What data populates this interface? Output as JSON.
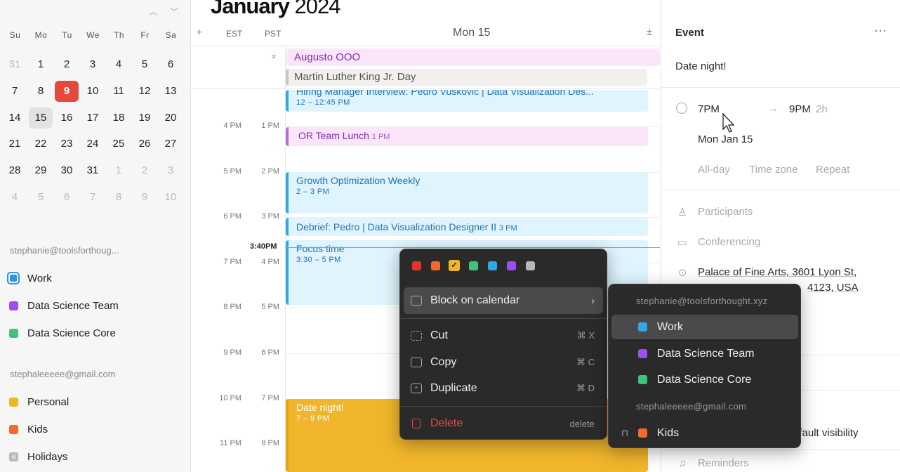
{
  "mini_calendar": {
    "weekdays": [
      "Su",
      "Mo",
      "Tu",
      "We",
      "Th",
      "Fr",
      "Sa"
    ],
    "weeks": [
      [
        "31",
        "1",
        "2",
        "3",
        "4",
        "5",
        "6"
      ],
      [
        "7",
        "8",
        "9",
        "10",
        "11",
        "12",
        "13"
      ],
      [
        "14",
        "15",
        "16",
        "17",
        "18",
        "19",
        "20"
      ],
      [
        "21",
        "22",
        "23",
        "24",
        "25",
        "26",
        "27"
      ],
      [
        "28",
        "29",
        "30",
        "31",
        "1",
        "2",
        "3"
      ],
      [
        "4",
        "5",
        "6",
        "7",
        "8",
        "9",
        "10"
      ]
    ],
    "today": "9",
    "selected": "15"
  },
  "accounts": [
    {
      "email": "stephanie@toolsforthoug...",
      "calendars": [
        {
          "name": "Work",
          "color": "#2c96e0"
        },
        {
          "name": "Data Science Team",
          "color": "#9a4ff0"
        },
        {
          "name": "Data Science Core",
          "color": "#3fc27a"
        }
      ]
    },
    {
      "email": "stephaleeeee@gmail.com",
      "calendars": [
        {
          "name": "Personal",
          "color": "#f0b52b"
        },
        {
          "name": "Kids",
          "color": "#f26a2e"
        },
        {
          "name": "Holidays",
          "color": "#b8b8b8"
        }
      ]
    }
  ],
  "main": {
    "title_month": "January",
    "title_year": "2024",
    "add_label": "+",
    "tz1": "EST",
    "tz2": "PST",
    "day_header": "Mon 15",
    "expand_label": "±",
    "now_time": "3:40PM",
    "hours_est": [
      "4 PM",
      "5 PM",
      "6 PM",
      "7 PM",
      "8 PM",
      "9 PM",
      "10 PM",
      "11 PM"
    ],
    "hours_pst": [
      "1 PM",
      "2 PM",
      "3 PM",
      "4 PM",
      "5 PM",
      "6 PM",
      "7 PM",
      "8 PM"
    ],
    "all_day": [
      {
        "title": "Augusto OOO"
      },
      {
        "title": "Martin Luther King Jr. Day"
      }
    ],
    "events": {
      "hiring": {
        "title": "Hiring Manager Interview: Pedro Vuskovic | Data Visualization Des...",
        "time": "12 – 12:45 PM"
      },
      "lunch": {
        "title": "OR Team Lunch",
        "time": "1 PM"
      },
      "growth": {
        "title": "Growth Optimization Weekly",
        "time": "2 – 3 PM"
      },
      "debrief": {
        "title": "Debrief: Pedro | Data Visualization Designer II",
        "time": "3 PM"
      },
      "focus": {
        "title": "Focus time",
        "time": "3:30 – 5 PM"
      },
      "date": {
        "title": "Date night!",
        "time": "7 – 9 PM"
      }
    }
  },
  "panel": {
    "header": "Event",
    "more": "···",
    "title": "Date night!",
    "start": "7PM",
    "end": "9PM",
    "duration": "2h",
    "date": "Mon Jan 15",
    "all_day": "All-day",
    "time_zone": "Time zone",
    "repeat": "Repeat",
    "participants": "Participants",
    "conferencing": "Conferencing",
    "location_line1": "Palace of Fine Arts, 3601 Lyon St,",
    "location_line2": "4123, USA",
    "visibility": "efault visibility",
    "reminders": "Reminders"
  },
  "menu": {
    "colors": [
      "#e5332a",
      "#f26a2e",
      "#f0b52b",
      "#3fc27a",
      "#2ea9e8",
      "#9a4ff0",
      "#b8b8b8"
    ],
    "block": "Block on calendar",
    "cut": "Cut",
    "cut_sc": "⌘ X",
    "copy": "Copy",
    "copy_sc": "⌘ C",
    "duplicate": "Duplicate",
    "duplicate_sc": "⌘ D",
    "delete": "Delete",
    "delete_sc": "delete"
  },
  "submenu": {
    "account1": "stephanie@toolsforthought.xyz",
    "account2": "stephaleeeee@gmail.com",
    "items": [
      {
        "name": "Work",
        "color": "#2ea9e8"
      },
      {
        "name": "Data Science Team",
        "color": "#9a4ff0"
      },
      {
        "name": "Data Science Core",
        "color": "#3fc27a"
      },
      {
        "name": "Kids",
        "color": "#f26a2e"
      }
    ]
  }
}
